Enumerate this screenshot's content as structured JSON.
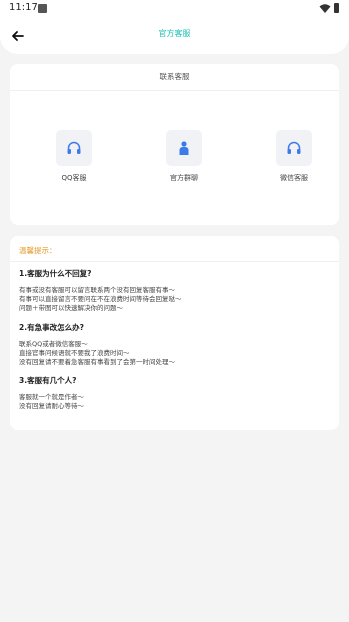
{
  "status_bar": {
    "time": "11:17"
  },
  "header": {
    "title": "官方客服"
  },
  "contact": {
    "title": "联系客服",
    "options": [
      {
        "label": "QQ客服",
        "icon": "headset-icon"
      },
      {
        "label": "官方群聊",
        "icon": "person-icon"
      },
      {
        "label": "微信客服",
        "icon": "headset-icon"
      }
    ]
  },
  "tips": {
    "heading": "温馨提示：",
    "faqs": [
      {
        "question": "1.客服为什么不回复?",
        "answers": [
          "有事或没有客服可以留言联系两个没有回复客服有事～",
          "有事可以直接留言不要问在不在浪费时间等待会回复哒～",
          "问题＋带图可以快速解决你的问题～"
        ]
      },
      {
        "question": "2.有急事改怎么办?",
        "answers": [
          "联系QQ或者微信客服～",
          "直接官事问候语就不要我了浪费时间～",
          "没有回复请不要着急客服有事看到了会第一时间处理～"
        ]
      },
      {
        "question": "3.客服有几个人?",
        "answers": [
          "客服就一个就是作者～",
          "没有回复请耐心等待～"
        ]
      }
    ]
  },
  "colors": {
    "accent": "#18c1b3",
    "warning": "#e59a29",
    "icon_blue": "#3d7be8",
    "background": "#f4f4f4"
  }
}
